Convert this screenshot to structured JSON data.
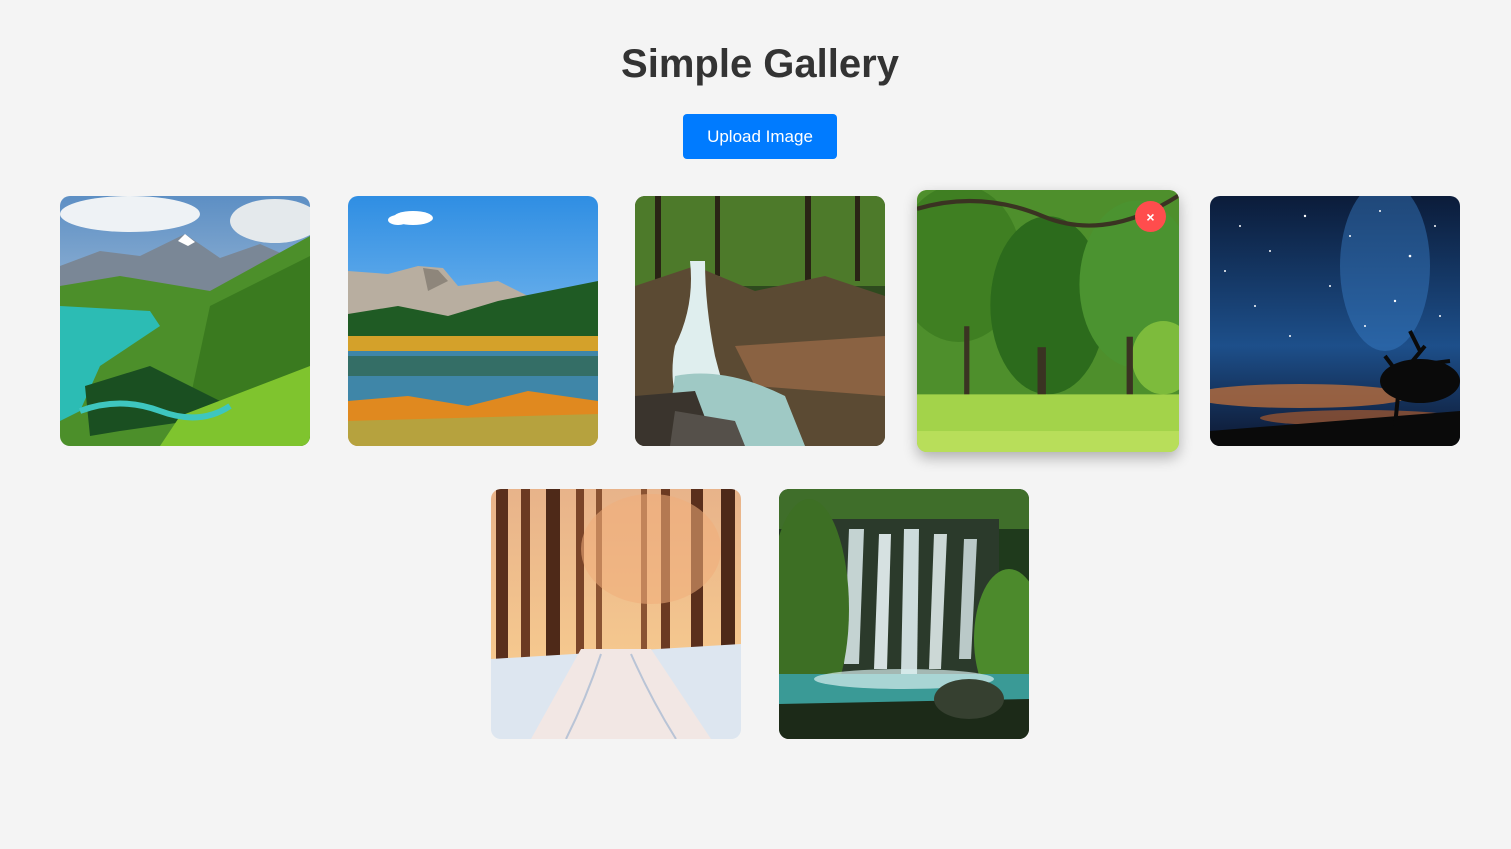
{
  "header": {
    "title": "Simple Gallery"
  },
  "toolbar": {
    "upload_label": "Upload Image"
  },
  "gallery": {
    "images": [
      {
        "subject": "mountain lake valley"
      },
      {
        "subject": "alpine lake reflection"
      },
      {
        "subject": "forest waterfall"
      },
      {
        "subject": "green park trees",
        "hovered": true,
        "delete_label": "×"
      },
      {
        "subject": "starry night sky"
      },
      {
        "subject": "snowy forest path"
      },
      {
        "subject": "jungle waterfall"
      }
    ]
  },
  "colors": {
    "background": "#f4f4f4",
    "accent": "#007bff",
    "delete": "#ff4d4d",
    "title": "#333333"
  }
}
